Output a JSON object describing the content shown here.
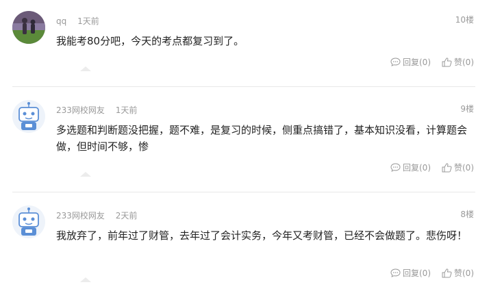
{
  "comments": [
    {
      "username": "qq",
      "time": "1天前",
      "floor": "10楼",
      "text": "我能考80分吧，今天的考点都复习到了。",
      "reply_label": "回复(0)",
      "like_label": "赞(0)",
      "avatar_icon": "photo-avatar"
    },
    {
      "username": "233网校网友",
      "time": "1天前",
      "floor": "9楼",
      "text": "多选题和判断题没把握，题不难，是复习的时候，侧重点搞错了，基本知识没看，计算题会做，但时间不够，惨",
      "reply_label": "回复(0)",
      "like_label": "赞(0)",
      "avatar_icon": "robot-avatar"
    },
    {
      "username": "233网校网友",
      "time": "2天前",
      "floor": "8楼",
      "text": "我放弃了，前年过了财管，去年过了会计实务，今年又考财管，已经不会做题了。悲伤呀！",
      "reply_label": "回复(0)",
      "like_label": "赞(0)",
      "avatar_icon": "robot-avatar"
    }
  ],
  "colors": {
    "meta_text": "#999999",
    "body_text": "#222222",
    "divider": "#e8e8e8",
    "robot_blue": "#5b8fd6"
  }
}
